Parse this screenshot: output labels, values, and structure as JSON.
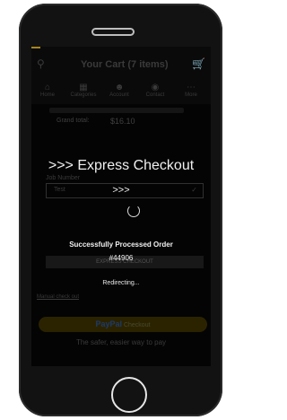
{
  "header": {
    "title": "Your Cart (7 items)"
  },
  "nav": {
    "items": [
      {
        "label": "Home",
        "icon": "home-icon"
      },
      {
        "label": "Categories",
        "icon": "book-icon"
      },
      {
        "label": "Account",
        "icon": "user-icon"
      },
      {
        "label": "Contact",
        "icon": "location-icon"
      },
      {
        "label": "More",
        "icon": "more-icon"
      }
    ]
  },
  "cart": {
    "subtotal_label": "Grand total:",
    "subtotal_value": "$16.10"
  },
  "overlay": {
    "heading": ">>> Express Checkout",
    "arrows": ">>>",
    "status": "Successfully Processed Order",
    "order_number": "#44906",
    "redirect": "Redirecting..."
  },
  "form": {
    "job_number_label": "Job Number",
    "job_number_value": "Test"
  },
  "buttons": {
    "express_checkout": "EXPRESS CHECKOUT",
    "manual_checkout": "Manual check out",
    "paypal_brand": "PayPal",
    "paypal_suffix": "Checkout"
  },
  "footer": {
    "tagline": "The safer, easier way to pay"
  },
  "colors": {
    "accent": "#a8861c",
    "background": "#040404",
    "paypal_button": "#2b2300"
  }
}
